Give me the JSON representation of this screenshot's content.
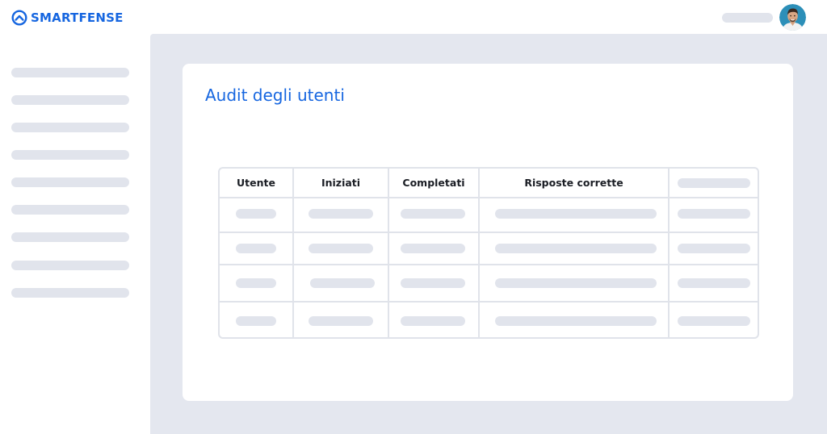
{
  "brand": {
    "name": "SMARTFENSE",
    "color": "#1666e0"
  },
  "header": {
    "avatar_icon": "user-avatar"
  },
  "sidebar": {
    "item_count": 9
  },
  "main": {
    "title": "Audit degli utenti",
    "table": {
      "columns": [
        "Utente",
        "Iniziati",
        "Completati",
        "Risposte corrette",
        ""
      ],
      "row_count": 4
    }
  },
  "colors": {
    "accent": "#1666e0",
    "placeholder": "#e1e4ec",
    "background": "#e4e7ef",
    "border": "#e0e3ea"
  }
}
